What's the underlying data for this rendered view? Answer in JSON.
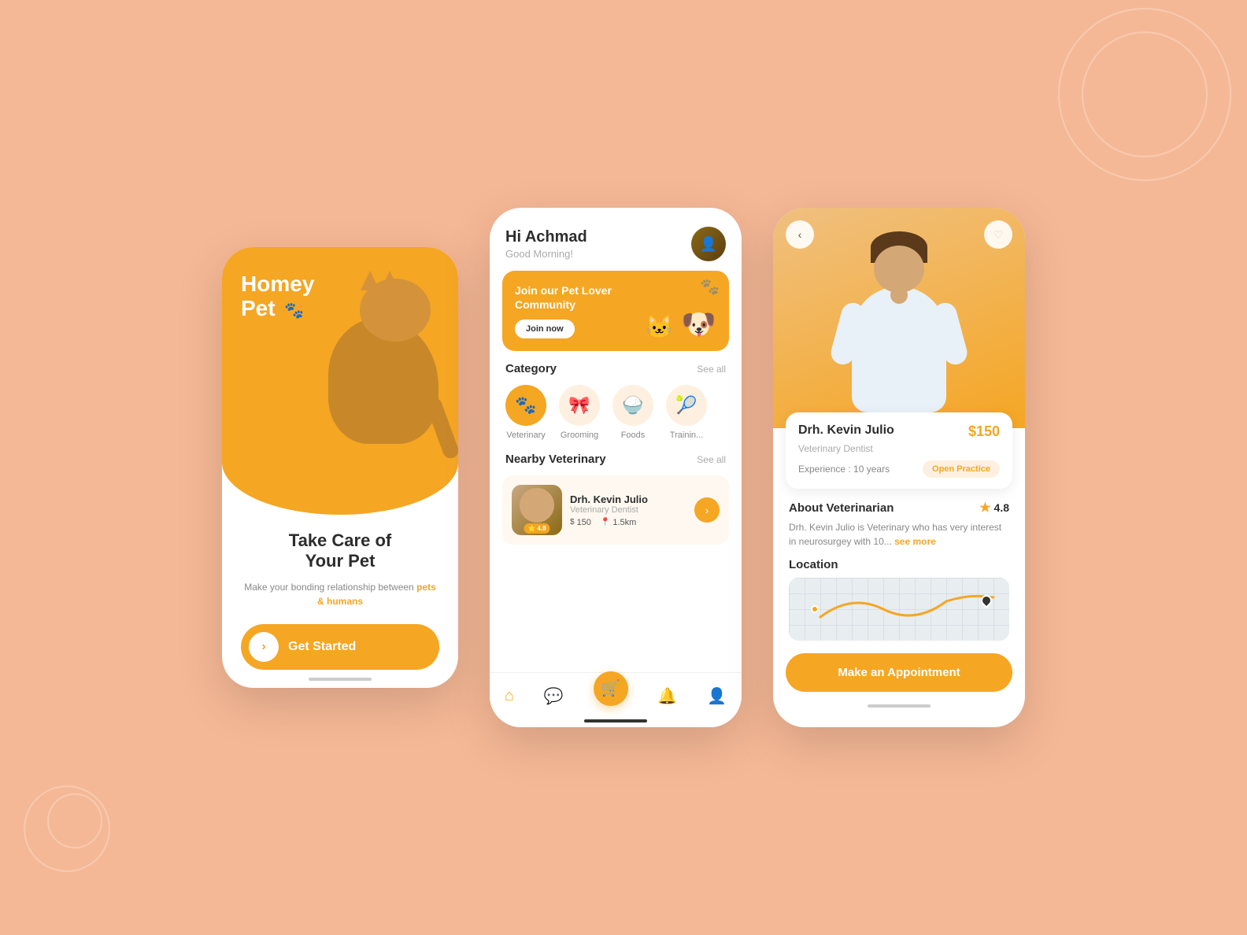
{
  "background": {
    "color": "#f5b896"
  },
  "phone1": {
    "app_name_line1": "Homey",
    "app_name_line2": "Pet",
    "tagline_line1": "Take Care of",
    "tagline_line2": "Your Pet",
    "subtitle": "Make your bonding relationship between ",
    "highlight": "pets & humans",
    "get_started_label": "Get Started"
  },
  "phone2": {
    "greeting_name": "Hi Achmad",
    "greeting_sub": "Good Morning!",
    "community_title_line1": "Join our Pet Lover",
    "community_title_line2": "Community",
    "join_btn": "Join now",
    "category_label": "Category",
    "see_all_1": "See all",
    "categories": [
      {
        "label": "Veterinary",
        "icon": "🐾",
        "active": true
      },
      {
        "label": "Grooming",
        "icon": "🎀",
        "active": false
      },
      {
        "label": "Foods",
        "icon": "🍽️",
        "active": false
      },
      {
        "label": "Training",
        "icon": "🎾",
        "active": false
      }
    ],
    "nearby_label": "Nearby Veterinary",
    "see_all_2": "See all",
    "vet_name": "Drh. Kevin Julio",
    "vet_spec": "Veterinary Dentist",
    "vet_rating": "4.8",
    "vet_price": "150",
    "vet_distance": "1.5km",
    "nav_items": [
      "home",
      "chat",
      "cart",
      "bell",
      "user"
    ]
  },
  "phone3": {
    "back_icon": "‹",
    "fav_icon": "♡",
    "vet_name": "Drh. Kevin Julio",
    "vet_price": "$150",
    "vet_specialty": "Veterinary Dentist",
    "experience": "Experience : 10 years",
    "open_practice": "Open Practice",
    "about_title": "About Veterinarian",
    "rating": "4.8",
    "about_text": "Drh. Kevin Julio is Veterinary who has very interest in neurosurgey with 10...",
    "see_more": "see more",
    "location_title": "Location",
    "appointment_btn": "Make an Appointment"
  }
}
